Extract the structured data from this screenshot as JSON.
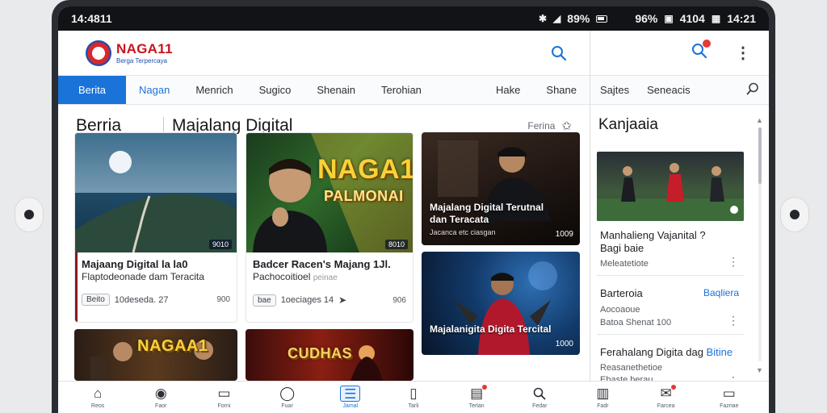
{
  "status_bar": {
    "time_left": "14:4811",
    "battery_pct": "89%",
    "signal_pct": "96%",
    "mid_value": "4104",
    "time_right": "14:21"
  },
  "app": {
    "logo_name": "NAGA11",
    "logo_tagline": "Berga Terpercaya",
    "brand_color": "#c9141d",
    "accent_color": "#1a73d9"
  },
  "nav": {
    "tabs": [
      "Berita",
      "Nagan",
      "Menrich",
      "Sugico",
      "Shenain",
      "Terohian"
    ],
    "right_tabs": [
      "Hake",
      "Shane"
    ],
    "active_index": 0
  },
  "section": {
    "title": "Berria",
    "subtitle": "Majalang Digital",
    "right_label": "Ferina"
  },
  "cards": [
    {
      "title": "Majaang Digital la la0",
      "sub": "Flaptodeonade dam Teracita",
      "pill": "Beito",
      "meta": "10deseda. 27",
      "count": "900",
      "badge": "9010"
    },
    {
      "title": "Badcer Racen's Majang 1Jl.",
      "sub": "Pachocoitioel",
      "sub2": "peinae",
      "pill": "bae",
      "meta": "1oeciages 14",
      "count": "906",
      "poster_line1": "NAGA1",
      "poster_line2": "PALMONAI",
      "badge": "8010"
    },
    {
      "title": "Majalang Digital Terutnal",
      "sub": "dan Teracata",
      "small": "Jacanca etc ciasgan",
      "count": "1009"
    },
    {
      "title": "Majalanigita Digita Tercital",
      "count": "1000"
    },
    {
      "poster": "NAGAA1"
    },
    {
      "poster": "CUDHAS"
    }
  ],
  "sidebar": {
    "tabs": [
      "Sajtes",
      "Seneacis"
    ],
    "title": "Kanjaaia",
    "items": [
      {
        "title": "Manhalieng Vajanital ?",
        "title2": "Bagi baie",
        "sub": "Meleatetiote"
      },
      {
        "title": "Barteroia",
        "link": "Baqliera",
        "sub": "Aocoaoue",
        "sub2": "Batoa Shenat 100"
      },
      {
        "title": "Ferahalang Digita dag",
        "link": "Bitine",
        "sub": "Reasanethetioe",
        "sub2": "Ebaste berau"
      }
    ]
  },
  "bottom_nav": [
    {
      "label": "Reos",
      "icon": "home-icon"
    },
    {
      "label": "Faor",
      "icon": "record-icon"
    },
    {
      "label": "Forni",
      "icon": "window-icon"
    },
    {
      "label": "Fuar",
      "icon": "chat-icon"
    },
    {
      "label": "Jamal",
      "icon": "article-icon"
    },
    {
      "label": "Tarli",
      "icon": "clipboard-icon"
    },
    {
      "label": "Terlan",
      "icon": "news-icon"
    },
    {
      "label": "Fedar",
      "icon": "search-icon"
    },
    {
      "label": "Fadr",
      "icon": "book-icon"
    },
    {
      "label": "Farcea",
      "icon": "message-icon"
    },
    {
      "label": "Fazriae",
      "icon": "folder-icon"
    }
  ]
}
